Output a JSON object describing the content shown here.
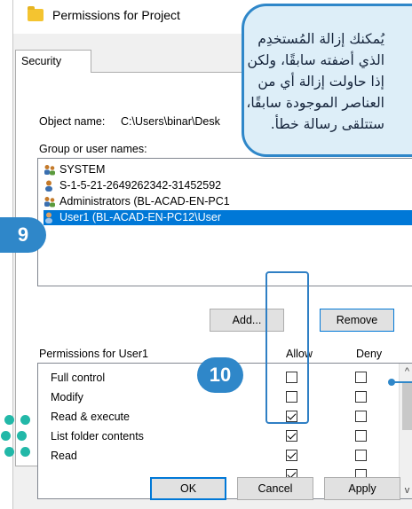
{
  "window": {
    "title": "Permissions for Project",
    "folder_icon": "folder-icon"
  },
  "tabs": [
    {
      "label": "Security",
      "active": true
    }
  ],
  "object": {
    "label": "Object name:",
    "value": "C:\\Users\\binar\\Desk"
  },
  "groups": {
    "label": "Group or user names:",
    "items": [
      {
        "name": "SYSTEM",
        "icon": "user-group-icon",
        "selected": false
      },
      {
        "name": "S-1-5-21-2649262342-31452592",
        "icon": "user-icon",
        "selected": false
      },
      {
        "name": "Administrators (BL-ACAD-EN-PC1",
        "icon": "user-group-icon",
        "selected": false
      },
      {
        "name": "User1 (BL-ACAD-EN-PC12\\User",
        "icon": "user-icon",
        "selected": true
      }
    ]
  },
  "buttons": {
    "add": "Add...",
    "remove": "Remove",
    "ok": "OK",
    "cancel": "Cancel",
    "apply": "Apply"
  },
  "permissions": {
    "label": "Permissions for User1",
    "allow_header": "Allow",
    "deny_header": "Deny",
    "items": [
      {
        "name": "Full control",
        "allow": false,
        "deny": false
      },
      {
        "name": "Modify",
        "allow": false,
        "deny": false
      },
      {
        "name": "Read & execute",
        "allow": true,
        "deny": false
      },
      {
        "name": "List folder contents",
        "allow": true,
        "deny": false
      },
      {
        "name": "Read",
        "allow": true,
        "deny": false
      }
    ],
    "scrollbar": {
      "up_arrow": "^",
      "down_arrow": "v"
    }
  },
  "callout": {
    "text": "يُمكنك إزالة المُستخدِم الذي أضفته سابقًا، ولكن إذا حاولت إزالة أي من العناصر الموجودة سابقًا، ستتلقى رسالة خطأ."
  },
  "badges": {
    "step_9": "9",
    "step_10": "10"
  },
  "colors": {
    "accent": "#2f87c9",
    "selection": "#0078d7",
    "callout_bg": "#ddeef8",
    "logo": "#22b8a8"
  }
}
